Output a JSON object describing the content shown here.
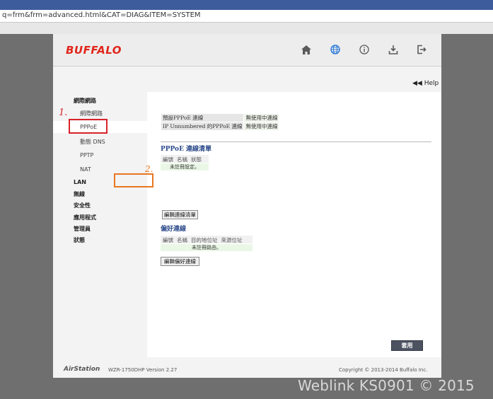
{
  "browser": {
    "address": "q=frm&frm=advanced.html&CAT=DIAG&ITEM=SYSTEM"
  },
  "header": {
    "logo": "BUFFALO",
    "icons": [
      "home-icon",
      "globe-icon",
      "info-icon",
      "download-icon",
      "logout-icon"
    ]
  },
  "help_label": "Help",
  "sidebar": {
    "groups": [
      {
        "label": "網際網路"
      },
      {
        "label": "網際網路"
      },
      {
        "label": "PPPoE"
      },
      {
        "label": "動態 DNS"
      },
      {
        "label": "PPTP"
      },
      {
        "label": "NAT"
      },
      {
        "label": "LAN"
      },
      {
        "label": "無線"
      },
      {
        "label": "安全性"
      },
      {
        "label": "應用程式"
      },
      {
        "label": "管理員"
      },
      {
        "label": "狀態"
      }
    ]
  },
  "annotations": {
    "one": "1.",
    "two": "2."
  },
  "settings": {
    "rows": [
      {
        "label": "預設PPPoE 連線",
        "value": "無使用中連線"
      },
      {
        "label": "IP Unnumbered 的PPPoE 連線",
        "value": "無使用中連線"
      }
    ]
  },
  "pppoe_list": {
    "title": "PPPoE 連線清單",
    "columns": [
      "編號",
      "名稱",
      "狀態"
    ],
    "empty": "未註冊設定。",
    "edit_button": "編輯連線清單"
  },
  "preferred": {
    "title": "偏好連線",
    "columns": [
      "編號",
      "名稱",
      "目的地位址",
      "來源位址"
    ],
    "empty": "未註冊路由。",
    "edit_button": "編輯偏好連線"
  },
  "apply_button": "套用",
  "footer": {
    "brand": "AirStation",
    "model": "WZR-1750DHP  Version 2.27",
    "copyright": "Copyright © 2013-2014 Buffalo Inc."
  },
  "watermark": "Weblink KS0901 © 2015",
  "colors": {
    "brand_red": "#e1261c",
    "apply_bg": "#4c5260",
    "annotation_red": "#d8232a",
    "annotation_orange": "#e87722"
  }
}
